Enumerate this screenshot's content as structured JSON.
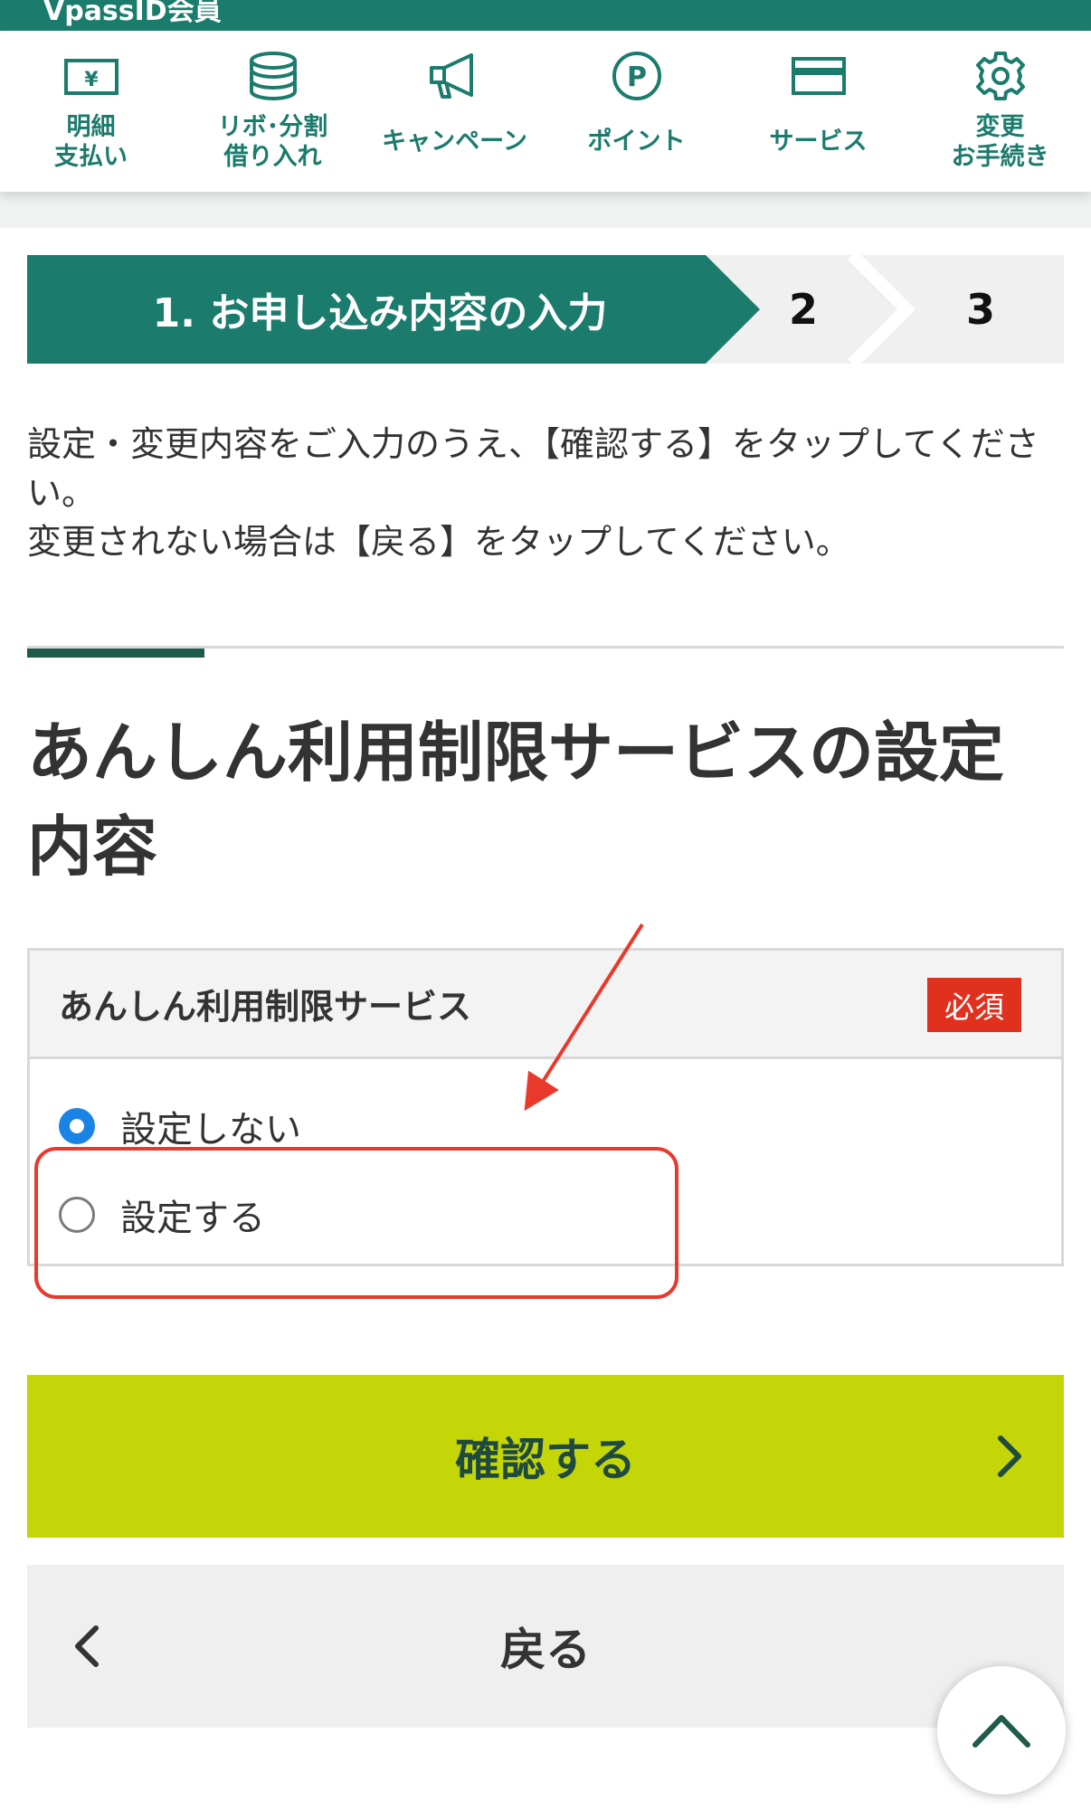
{
  "header": {
    "member_label": "VpassID会員"
  },
  "nav": [
    {
      "icon": "yen-card-icon",
      "label": "明細\n支払い"
    },
    {
      "icon": "coins-icon",
      "label": "リボ･分割\n借り入れ"
    },
    {
      "icon": "megaphone-icon",
      "label": "キャンペーン"
    },
    {
      "icon": "point-icon",
      "label": "ポイント"
    },
    {
      "icon": "card-icon",
      "label": "サービス"
    },
    {
      "icon": "gear-icon",
      "label": "変更\nお手続き"
    }
  ],
  "steps": {
    "active": "1. お申し込み内容の入力",
    "step2": "2",
    "step3": "3"
  },
  "intro": {
    "line1": "設定・変更内容をご入力のうえ、【確認する】をタップしてください。",
    "line2": "変更されない場合は【戻る】をタップしてください。"
  },
  "section_title": "あんしん利用制限サービスの設定内容",
  "panel": {
    "title": "あんしん利用制限サービス",
    "required": "必須",
    "options": [
      {
        "label": "設定しない",
        "selected": true
      },
      {
        "label": "設定する",
        "selected": false
      }
    ]
  },
  "buttons": {
    "confirm": "確認する",
    "back": "戻る"
  },
  "colors": {
    "brand_green": "#1b7b6c",
    "confirm_lime": "#c4d508",
    "required_red": "#e0301e",
    "annotation_red": "#e8392c",
    "radio_blue": "#1a83e6"
  }
}
